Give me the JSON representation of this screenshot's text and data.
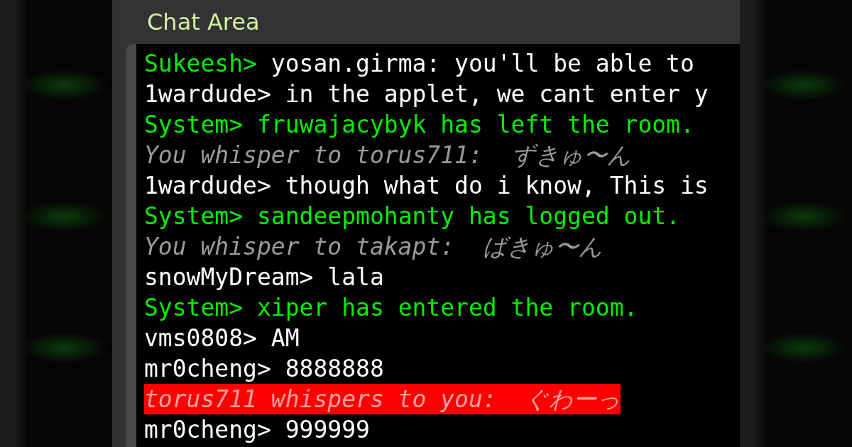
{
  "panel": {
    "title": "Chat Area"
  },
  "lines": [
    {
      "kind": "staff",
      "speaker": "Sukeesh>",
      "text": "yosan.girma: you'll be able to"
    },
    {
      "kind": "user",
      "speaker": "1wardude>",
      "text": "in the applet, we cant enter y"
    },
    {
      "kind": "system",
      "speaker": "System>",
      "text": "fruwajacybyk has left the room."
    },
    {
      "kind": "whisper",
      "speaker": "You whisper to torus711:",
      "text": "ずきゅ〜ん"
    },
    {
      "kind": "user",
      "speaker": "1wardude>",
      "text": "though what do i know, This is"
    },
    {
      "kind": "system",
      "speaker": "System>",
      "text": "sandeepmohanty has logged out."
    },
    {
      "kind": "whisper",
      "speaker": "You whisper to takapt:",
      "text": "ばきゅ〜ん"
    },
    {
      "kind": "user",
      "speaker": "snowMyDream>",
      "text": "lala"
    },
    {
      "kind": "system",
      "speaker": "System>",
      "text": "xiper has entered the room."
    },
    {
      "kind": "user",
      "speaker": "vms0808>",
      "text": "AM"
    },
    {
      "kind": "user",
      "speaker": "mr0cheng>",
      "text": "8888888"
    },
    {
      "kind": "whisper_received",
      "speaker": "torus711 whispers to you:",
      "text": "ぐわーっ"
    },
    {
      "kind": "user",
      "speaker": "mr0cheng>",
      "text": "999999"
    }
  ]
}
